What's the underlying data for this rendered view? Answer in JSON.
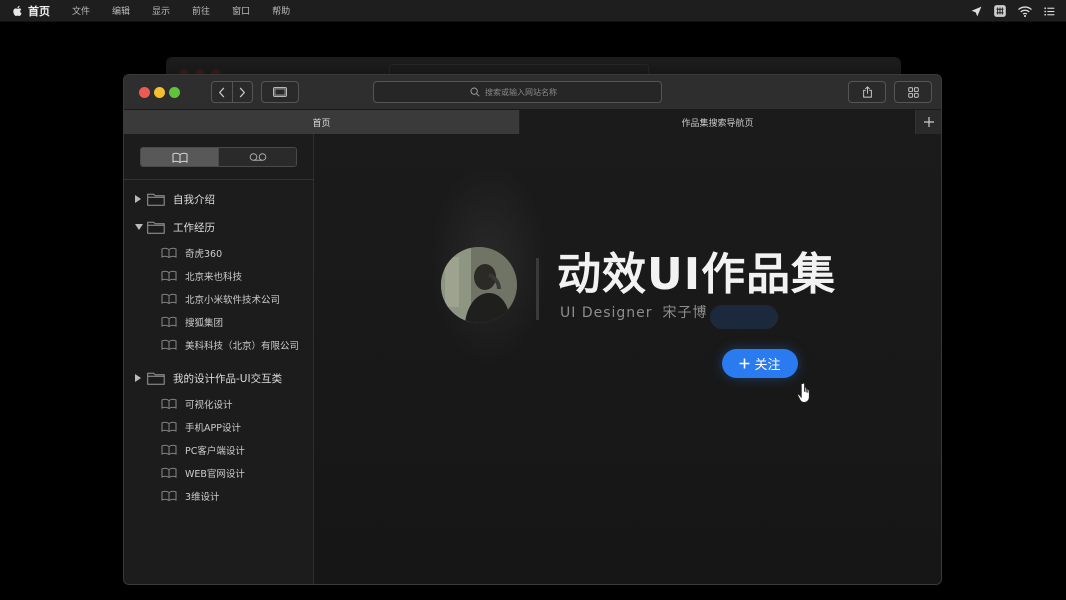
{
  "menubar": {
    "app_name": "首页",
    "items": [
      "文件",
      "编辑",
      "显示",
      "前往",
      "窗口",
      "帮助"
    ],
    "right_icons": [
      "location-arrow-icon",
      "grid-app-icon",
      "wifi-icon",
      "list-icon"
    ]
  },
  "window": {
    "address_placeholder": "搜索或输入网站名称",
    "tabs": [
      {
        "label": "首页",
        "active": true
      },
      {
        "label": "作品集搜索导航页",
        "active": false
      }
    ],
    "new_tab_icon": "plus-icon"
  },
  "sidebar": {
    "segments": [
      "bookmarks-icon",
      "reading-list-icon"
    ],
    "tree": [
      {
        "type": "folder",
        "label": "自我介绍",
        "expanded": false
      },
      {
        "type": "folder",
        "label": "工作经历",
        "expanded": true,
        "children": [
          "奇虎360",
          "北京来也科技",
          "北京小米软件技术公司",
          "搜狐集团",
          "美科科技（北京）有限公司"
        ]
      },
      {
        "type": "folder",
        "label": "我的设计作品-UI交互类",
        "expanded": false,
        "children": [
          "可视化设计",
          "手机APP设计",
          "PC客户端设计",
          "WEB官网设计",
          "3维设计"
        ]
      }
    ]
  },
  "hero": {
    "title": "动效UI作品集",
    "subtitle_role": "UI Designer",
    "subtitle_name": "宋子博",
    "follow_label": "关注",
    "accent_color": "#2a7bf0"
  }
}
